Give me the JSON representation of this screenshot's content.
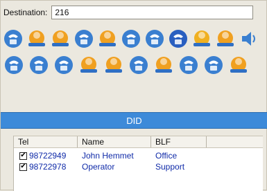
{
  "destination": {
    "label": "Destination:",
    "value": "216"
  },
  "toolbar": {
    "row1": [
      {
        "icon": "phone-keypad-icon",
        "color": "#3a7fd0"
      },
      {
        "icon": "user-transfer-icon",
        "color": "#f0a020"
      },
      {
        "icon": "user-transfer-alt-icon",
        "color": "#f0a020"
      },
      {
        "icon": "phone-music-icon",
        "color": "#3a7fd0"
      },
      {
        "icon": "user-hold-icon",
        "color": "#f0a020"
      },
      {
        "icon": "phone-reload-icon",
        "color": "#3a7fd0"
      },
      {
        "icon": "phone-park-icon",
        "color": "#3a7fd0"
      },
      {
        "icon": "parking-icon",
        "color": "#2a5fc0"
      },
      {
        "icon": "handset-banana-icon",
        "color": "#f0b020"
      },
      {
        "icon": "user-list-icon",
        "color": "#f0a020"
      },
      {
        "icon": "speaker-icon",
        "color": "#3a7fd0"
      }
    ],
    "row2": [
      {
        "icon": "phone-multi-icon",
        "color": "#3a7fd0"
      },
      {
        "icon": "arrow-forward-icon",
        "color": "#3a7fd0"
      },
      {
        "icon": "card-transfer-icon",
        "color": "#3a7fd0"
      },
      {
        "icon": "user-forward-icon",
        "color": "#f0a020"
      },
      {
        "icon": "user-eraser-icon",
        "color": "#f0a020"
      },
      {
        "icon": "phone-arrow-icon",
        "color": "#3a7fd0"
      },
      {
        "icon": "user-phone-icon",
        "color": "#f0a020"
      },
      {
        "icon": "phone-loop-icon",
        "color": "#3a7fd0"
      },
      {
        "icon": "phone-timer-icon",
        "color": "#3a7fd0"
      },
      {
        "icon": "user-record-icon",
        "color": "#f0a020"
      }
    ]
  },
  "did": {
    "title": "DID",
    "columns": [
      "Tel",
      "Name",
      "BLF"
    ],
    "rows": [
      {
        "checked": true,
        "tel": "98722949",
        "name": "John Hemmet",
        "blf": "Office"
      },
      {
        "checked": true,
        "tel": "98722978",
        "name": "Operator",
        "blf": "Support"
      }
    ]
  }
}
